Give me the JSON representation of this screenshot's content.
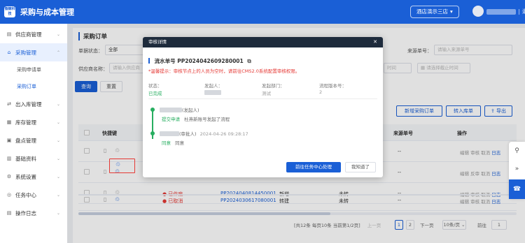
{
  "app": {
    "logo_text": "微鲸科技",
    "title": "采购与成本管理"
  },
  "header": {
    "store_label": "酒店演示三店",
    "store_chevron": "▾",
    "separator": "|",
    "logout": "退出"
  },
  "sidebar": {
    "items": [
      {
        "label": "供应商管理",
        "icon": "▤",
        "chevron": "⌄"
      },
      {
        "label": "采购管理",
        "icon": "⌂",
        "chevron": "⌃",
        "active": true,
        "children": [
          {
            "label": "采购申请单"
          },
          {
            "label": "采购订单",
            "active": true
          }
        ]
      },
      {
        "label": "出入库管理",
        "icon": "⇄",
        "chevron": "⌄"
      },
      {
        "label": "库存管理",
        "icon": "▦",
        "chevron": "⌄"
      },
      {
        "label": "盘点管理",
        "icon": "▣",
        "chevron": "⌄"
      },
      {
        "label": "基础资料",
        "icon": "▥",
        "chevron": "⌄"
      },
      {
        "label": "系统设置",
        "icon": "⚙",
        "chevron": "⌄"
      },
      {
        "label": "任务中心",
        "icon": "◎",
        "chevron": "⌄"
      },
      {
        "label": "操作日志",
        "icon": "▤",
        "chevron": "⌄"
      }
    ]
  },
  "page": {
    "title": "采购订单"
  },
  "filters": {
    "status_label": "单据状态：",
    "status_value": "全部",
    "source_label": "来源单号：",
    "source_placeholder": "请输入来源单号",
    "supplier_label": "供应商名称：",
    "supplier_placeholder": "请输入供应商",
    "start_placeholder": "时间",
    "end_placeholder": "请选择截止时间",
    "calendar_icon": "▦",
    "query_button": "查询",
    "reset_button": "重置"
  },
  "actions": {
    "new_order": "新增采购订单",
    "to_inbound": "转入库单",
    "export": "导出"
  },
  "table": {
    "headers": {
      "shortcut": "快捷键",
      "source_no": "来源单号",
      "ops": "操作"
    },
    "rows": [
      {
        "source": "--",
        "ops": [
          "编辑",
          "审核",
          "取消",
          "日志"
        ]
      },
      {
        "source": "--",
        "ops": [
          "编辑",
          "反审",
          "取消",
          "日志"
        ]
      },
      {
        "status": "● 已作废",
        "order_no": "PP2024040814450001",
        "type": "新增",
        "transfer": "未转",
        "source": "--",
        "ops": [
          "编辑",
          "审核",
          "取消",
          "日志"
        ]
      },
      {
        "status": "● 已取消",
        "order_no": "PP2024030617080001",
        "type": "转建",
        "transfer": "未转",
        "source": "--",
        "ops": [
          "编辑",
          "审核",
          "取消",
          "日志"
        ]
      }
    ]
  },
  "pager": {
    "summary": "[共12条 每页10条 当前第1/2页]",
    "prev": "上一页",
    "page1": "1",
    "page2": "2",
    "next": "下一页",
    "size": "10条/页 ⌄",
    "goto_label": "前往",
    "goto_value": "1",
    "page_unit": "页"
  },
  "modal": {
    "title": "审核详情",
    "close": "✕",
    "serial_label": "流水单号",
    "serial_no": "PP2024042609280001",
    "copy_icon": "⧉",
    "warning": "*温馨提示：审核节点上的人员为空时，请前往CMS2.0系统配置审核权限。",
    "status_label": "状态：",
    "status_value": "已完成",
    "initiator_label": "发起人：",
    "dept_label": "发起部门：",
    "dept_value": "测试",
    "version_label": "流程版本号：",
    "version_value": "2",
    "timeline": [
      {
        "role": "(发起人)",
        "action": "提交申请",
        "comment": "杜燕新账号发起了流程"
      },
      {
        "role": "(审批人)",
        "time": "2024-04-26 09:28:17",
        "action": "同意",
        "comment": "同意"
      }
    ],
    "primary_button": "前往任务中心处理",
    "secondary_button": "我知道了"
  },
  "floating": {
    "link_icon": "⚲",
    "collapse_icon": "»",
    "support_icon": "☎"
  }
}
